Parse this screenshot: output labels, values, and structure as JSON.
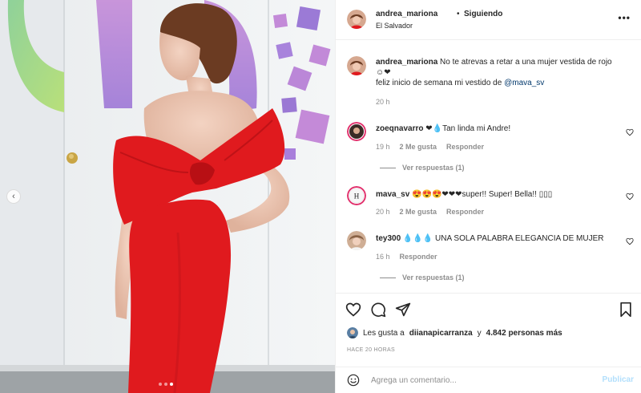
{
  "post": {
    "username": "andrea_mariona",
    "separator": "•",
    "follow_status": "Siguiendo",
    "location": "El Salvador",
    "more_icon": "more-horizontal-icon"
  },
  "caption": {
    "username": "andrea_mariona",
    "text_line1": "No te atrevas a retar a una mujer vestida de rojo",
    "emoji_line": "☺❤",
    "text_line2_prefix": "feliz inicio de semana mi vestido de",
    "mention": "@mava_sv",
    "time": "20 h"
  },
  "comments": [
    {
      "username": "zoeqnavarro",
      "text": "❤💧Tan linda mi Andre!",
      "time": "19 h",
      "likes": "2 Me gusta",
      "reply": "Responder",
      "replies_link": "Ver respuestas (1)"
    },
    {
      "username": "mava_sv",
      "text": "😍😍😍❤❤❤super!! Super! Bella!! ▯▯▯",
      "time": "20 h",
      "likes": "2 Me gusta",
      "reply": "Responder",
      "replies_link": ""
    },
    {
      "username": "tey300",
      "text": "💧💧💧 UNA SOLA PALABRA ELEGANCIA DE MUJER",
      "time": "16 h",
      "likes": "",
      "reply": "Responder",
      "replies_link": "Ver respuestas (1)"
    }
  ],
  "actions": {
    "like_icon": "heart-icon",
    "comment_icon": "comment-icon",
    "share_icon": "send-icon",
    "save_icon": "bookmark-icon"
  },
  "likes": {
    "prefix": "Les gusta a",
    "user": "diianapicarranza",
    "connector": "y",
    "count": "4.842 personas más"
  },
  "timestamp": "HACE 20 HORAS",
  "composer": {
    "placeholder": "Agrega un comentario...",
    "publish_label": "Publicar"
  },
  "carousel": {
    "total": 3,
    "active_index": 2
  },
  "colors": {
    "dress_red": "#e01a1e",
    "link_blue": "#00376b",
    "publish_disabled": "#b2dffc",
    "muted_text": "#8e8e8e"
  }
}
